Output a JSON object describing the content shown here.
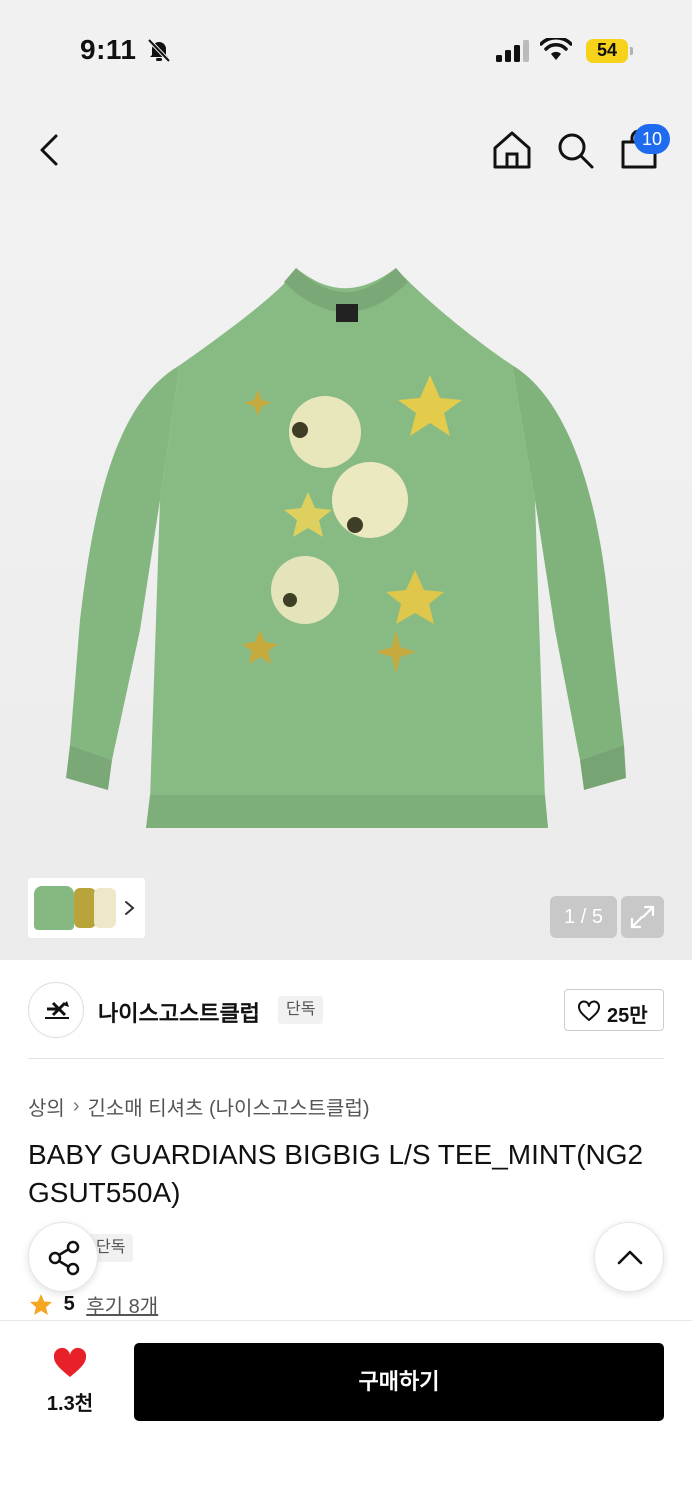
{
  "status_bar": {
    "time": "9:11",
    "battery": "54"
  },
  "nav": {
    "cart_count": "10"
  },
  "gallery": {
    "counter": "1 / 5"
  },
  "brand": {
    "name": "나이스고스트클럽",
    "tag": "단독",
    "likes": "25만"
  },
  "breadcrumb": {
    "category": "상의",
    "subcategory": "긴소매 티셔츠 (나이스고스트클럽)"
  },
  "product": {
    "title": "BABY GUARDIANS BIGBIG L/S TEE_MINT(NG2GSUT550A)",
    "tag": "단독",
    "rating": "5",
    "reviews": "후기 8개"
  },
  "bottom": {
    "wish_count": "1.3천",
    "buy_label": "구매하기"
  },
  "colors": {
    "shirt": "#86b882",
    "accent_badge": "#1e6bf0",
    "heart": "#e8202a",
    "star": "#f5a623"
  },
  "icons": [
    "bell-off-icon",
    "signal-icon",
    "wifi-icon",
    "back-icon",
    "home-icon",
    "search-icon",
    "cart-icon",
    "chevron-right-icon",
    "expand-icon",
    "heart-outline-icon",
    "share-icon",
    "chevron-up-icon",
    "star-icon",
    "heart-filled-icon"
  ]
}
